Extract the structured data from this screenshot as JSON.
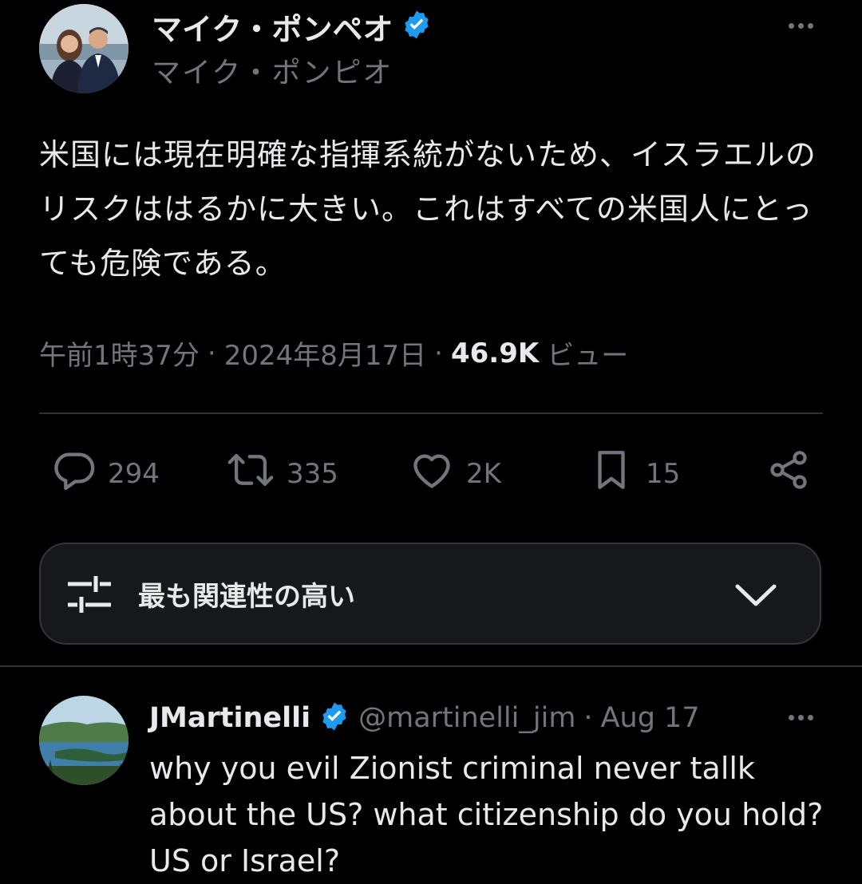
{
  "tweet": {
    "display_name": "マイク・ポンペオ",
    "handle": "マイク・ポンピオ",
    "text": "米国には現在明確な指揮系統がないため、イスラエルのリスクははるかに大きい。これはすべての米国人にとっても危険である。",
    "time": "午前1時37分",
    "date": "2024年8月17日",
    "views_count": "46.9K",
    "views_label": "ビュー"
  },
  "actions": {
    "replies": "294",
    "retweets": "335",
    "likes": "2K",
    "bookmarks": "15"
  },
  "filter": {
    "label": "最も関連性の高い"
  },
  "reply": {
    "display_name": "JMartinelli",
    "handle": "@martinelli_jim",
    "date": "Aug 17",
    "text": "why you evil Zionist criminal never tallk about the US? what citizenship do you hold? US or Israel?"
  },
  "colors": {
    "background": "#000000",
    "text": "#e7e9ea",
    "muted": "#71767b",
    "verified": "#1d9bf0",
    "divider": "#2f3336"
  }
}
